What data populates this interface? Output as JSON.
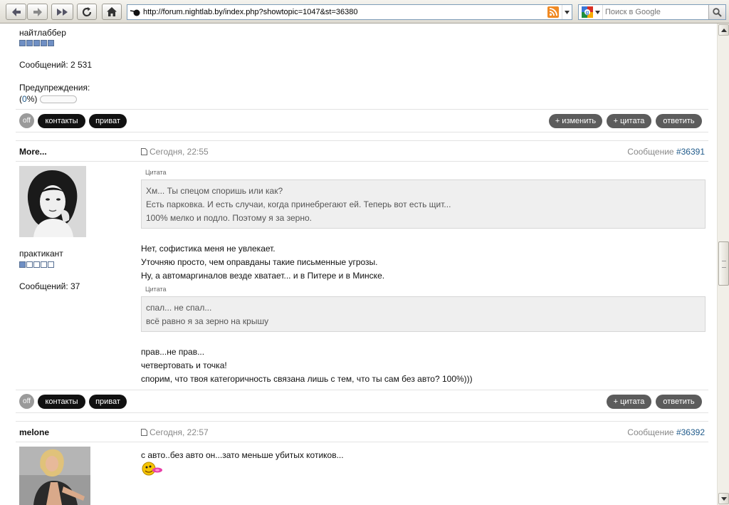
{
  "browser": {
    "url": "http://forum.nightlab.by/index.php?showtopic=1047&st=36380",
    "search_placeholder": "Поиск в Google"
  },
  "prev_post": {
    "rank": "найтлаббер",
    "rank_stars": 5,
    "messages": "Сообщений: 2 531",
    "warnings_label": "Предупреждения:",
    "warn_open": "(",
    "warn_value": "0",
    "warn_close": "%)",
    "warn_percent": 0,
    "actions": {
      "status": "off",
      "contacts": "контакты",
      "private": "приват",
      "edit": "+ изменить",
      "quote": "+ цитата",
      "reply": "ответить"
    }
  },
  "post1": {
    "author": "More...",
    "date": "Сегодня, 22:55",
    "msg_prefix": "Сообщение",
    "msg_id": "#36391",
    "rank": "практикант",
    "rank_stars": 1,
    "messages": "Сообщений: 37",
    "quote1_label": "Цитата",
    "quote1": [
      "Хм... Ты спецом споришь или как?",
      "Есть парковка. И есть случаи, когда принебрегают ей. Теперь вот есть щит...",
      "100% мелко и подло. Поэтому я за зерно."
    ],
    "text1": [
      "Нет, софистика меня не увлекает.",
      "Уточняю просто, чем оправданы такие письменные угрозы.",
      "Ну, а автомаргиналов везде хватает... и в Питере и в Минске."
    ],
    "quote2_label": "Цитата",
    "quote2": [
      "спал... не спал...",
      "всё равно я за зерно на крышу"
    ],
    "text2": [
      "прав...не прав...",
      "четвертовать и точка!",
      "спорим, что твоя категоричность связана лишь с тем, что ты сам без авто? 100%)))"
    ],
    "actions": {
      "status": "off",
      "contacts": "контакты",
      "private": "приват",
      "quote": "+ цитата",
      "reply": "ответить"
    }
  },
  "post2": {
    "author": "melone",
    "date": "Сегодня, 22:57",
    "msg_prefix": "Сообщение",
    "msg_id": "#36392",
    "text": "с авто..без авто он...зато меньше убитых котиков..."
  },
  "colors": {
    "link": "#1f5a8a",
    "pill_dark": "#111111",
    "pill_gray": "#5c5c5c",
    "quote_bg": "#efefef"
  }
}
